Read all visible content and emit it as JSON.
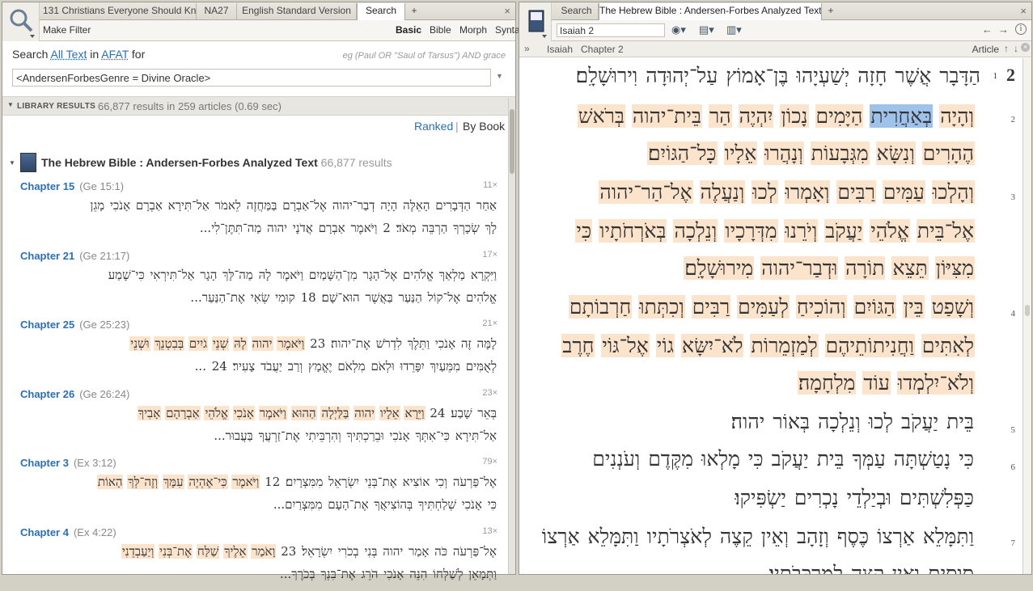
{
  "left": {
    "tabs": [
      "131 Christians Everyone Should Know",
      "NA27",
      "English Standard Version",
      "Search"
    ],
    "new_tab": "+",
    "close": "×",
    "make_filter": "Make Filter",
    "modes": [
      "Basic",
      "Bible",
      "Morph",
      "Syntax"
    ],
    "search_prefix": "Search",
    "scope": "All Text",
    "in_word": "in",
    "collection": "AFAT",
    "for_word": "for",
    "example": "eg (Paul OR \"Saul of Tarsus\") AND grace",
    "query": "<AndersenForbesGenre = Divine Oracle>",
    "results_header": "LIBRARY RESULTS",
    "results_summary": "66,877 results in 259 articles (0.69 sec)",
    "ranked": "Ranked",
    "sep": "|",
    "by_book": "By Book",
    "book_title": "The Hebrew Bible : Andersen-Forbes Analyzed Text",
    "book_count": "66,877 results",
    "results": [
      {
        "chapter": "Chapter 15",
        "ref": "(Ge 15:1)",
        "count": "11×",
        "l1": "אַחַר הַדְּבָרִים הָאֵלֶּה הָיָה דְבַר־יהוה אֶל־אַבְרָם בַּמַּחֲזֶה לֵאמֹר אַל־תִּירָא אַבְרָם אָנֹכִי מָגֵן",
        "l2": "לָךְ שְׂכָרְךָ הַרְבֵּה מְאֹד׃ 2 וַיֹּאמֶר אַבְרָם אֲדֹנָי יהוה מַה־תִּתֶּן־לִי..."
      },
      {
        "chapter": "Chapter 21",
        "ref": "(Ge 21:17)",
        "count": "17×",
        "l1": "וַיִּקְרָא מַלְאַךְ אֱלֹהִים אֶל־הָגָר מִן־הַשָּׁמַיִם וַיֹּאמֶר לָהּ מַה־לָּךְ הָגָר אַל־תִּירְאִי כִּי־שָׁמַע",
        "l2": "אֱלֹהִים אֶל־קוֹל הַנַּעַר בַּאֲשֶׁר הוּא־שָׁם׃ 18 קוּמִי שְׂאִי אֶת־הַנַּעַר..."
      },
      {
        "chapter": "Chapter 25",
        "ref": "(Ge 25:23)",
        "count": "21×",
        "l1": "לָמָּה זֶּה אָנֹכִי וַתֵּלֶךְ לִדְרֹשׁ אֶת־יהוה׃ 23 וַיֹּאמֶר יהוה לָהּ שְׁנֵי גֹיִים בְּבִטְנֵךְ וּשְׁנֵי",
        "l2": "לְאֻמִּים מִמֵּעַיִךְ יִפָּרֵדוּ וּלְאֹם מִלְאֹם יֶאֱמָץ וְרַב יַעֲבֹד צָעִיר׃ 24 ..."
      },
      {
        "chapter": "Chapter 26",
        "ref": "(Ge 26:24)",
        "count": "23×",
        "l1": "בְּאֵר שָׁבַע׃ 24 וַיֵּרָא אֵלָיו יהוה בַּלַּיְלָה הַהוּא וַיֹּאמֶר אָנֹכִי אֱלֹהֵי אַבְרָהָם אָבִיךָ",
        "l2": "אַל־תִּירָא כִּי־אִתְּךָ אָנֹכִי וּבֵרַכְתִּיךָ וְהִרְבֵּיתִי אֶת־זַרְעֲךָ בַּעֲבוּר..."
      },
      {
        "chapter": "Chapter 3",
        "ref": "(Ex 3:12)",
        "count": "79×",
        "l1": "אֶל־פַּרְעֹה וְכִי אוֹצִיא אֶת־בְּנֵי יִשְׂרָאֵל מִמִּצְרָיִם׃ 12 וַיֹּאמֶר כִּי־אֶהְיֶה עִמָּךְ וְזֶה־לְּךָ הָאוֹת",
        "l2": "כִּי אָנֹכִי שְׁלַחְתִּיךָ בְּהוֹצִיאֲךָ אֶת־הָעָם מִמִּצְרַיִם..."
      },
      {
        "chapter": "Chapter 4",
        "ref": "(Ex 4:22)",
        "count": "13×",
        "l1": "אֶל־פַּרְעֹה כֹּה אָמַר יהוה בְּנִי בְכֹרִי יִשְׂרָאֵל׃ 23 וָאֹמַר אֵלֶיךָ שַׁלַּח אֶת־בְּנִי וְיַעַבְדֵנִי",
        "l2": "וַתְּמָאֵן לְשַׁלְּחוֹ הִנֵּה אָנֹכִי הֹרֵג אֶת־בִּנְךָ בְּכֹרֶךָ..."
      }
    ]
  },
  "right": {
    "tabs": [
      "Search",
      "The Hebrew Bible : Andersen-Forbes Analyzed Text"
    ],
    "new_tab": "+",
    "close": "×",
    "reference": "Isaiah 2",
    "nav_back": "←",
    "nav_fwd": "→",
    "info": "i",
    "expand": "»",
    "crumb1": "Isaiah",
    "crumb2": "Chapter 2",
    "article": "Article",
    "chapter_num": "2",
    "verse1_num": "1",
    "lines": [
      "הַדָּבָר אֲשֶׁר חָזָה יְשַׁעְיָהוּ בֶּן־אָמוֹץ עַל־יְהוּדָה וִירוּשָׁלִָם׃",
      "וְהָיָה בְּאַחֲרִית הַיָּמִים נָכוֹן יִהְיֶה הַר בֵּית־יהוה בְּרֹאשׁ",
      "הֶהָרִים וְנִשָּׂא מִגְּבָעוֹת וְנָהֲרוּ אֵלָיו כָּל־הַגּוֹיִם׃",
      "וְהָלְכוּ עַמִּים רַבִּים וְאָמְרוּ לְכוּ וְנַעֲלֶה אֶל־הַר־יהוה",
      "אֶל־בֵּית אֱלֹהֵי יַעֲקֹב וְיֹרֵנוּ מִדְּרָכָיו וְנֵלְכָה בְּאֹרְחֹתָיו כִּי",
      "מִצִּיּוֹן תֵּצֵא תוֹרָה וּדְבַר־יהוה מִירוּשָׁלִָם׃",
      "וְשָׁפַט בֵּין הַגּוֹיִם וְהוֹכִיחַ לְעַמִּים רַבִּים וְכִתְּתוּ חַרְבוֹתָם",
      "לְאִתִּים וַחֲנִיתוֹתֵיהֶם לְמַזְמֵרוֹת לֹא־יִשָּׂא גוֹי אֶל־גּוֹי חֶרֶב",
      "וְלֹא־יִלְמְדוּ עוֹד מִלְחָמָה׃",
      "בֵּית יַעֲקֹב לְכוּ וְנֵלְכָה בְּאוֹר יהוה׃",
      "כִּי נָטַשְׁתָּה עַמְּךָ בֵּית יַעֲקֹב כִּי מָלְאוּ מִקֶּדֶם וְעֹנְנִים",
      "כַּפְּלִשְׁתִּים וּבְיַלְדֵי נָכְרִים יַשְׂפִּיקוּ׃",
      "וַתִּמָּלֵא אַרְצוֹ כֶּסֶף וְזָהָב וְאֵין קֵצֶה לְאֹצְרֹתָיו וַתִּמָּלֵא אַרְצוֹ",
      "סוּסִים וְאֵין קֵצֶה לְמַרְכְּבֹתָיו׃"
    ],
    "verse_nums": [
      "2",
      "3",
      "4",
      "5",
      "6",
      "7"
    ]
  },
  "colors": {
    "highlight": "#fbe3cc",
    "selection": "#9fc2ea",
    "link": "#2c6fb3"
  }
}
